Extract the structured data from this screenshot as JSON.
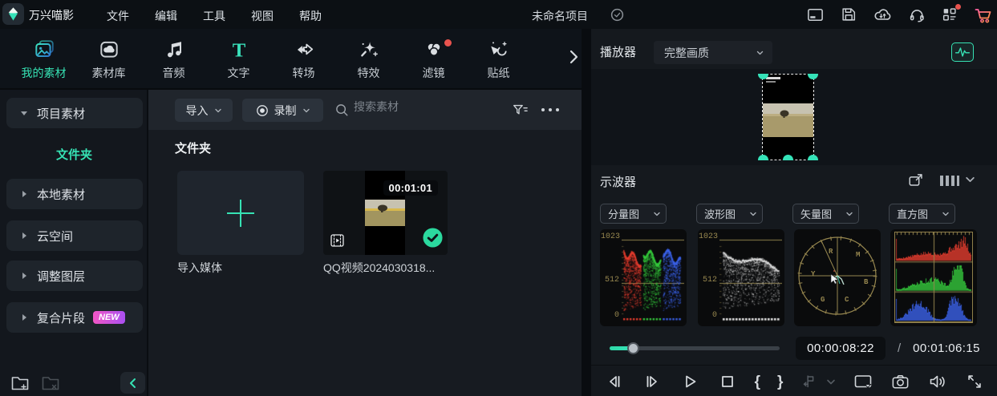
{
  "colors": {
    "accent": "#36e2b4",
    "scope_grid": "#97874f",
    "badge_red": "#e8534e",
    "check_green": "#2bd99e"
  },
  "menubar": {
    "app_name": "万兴喵影",
    "items": [
      {
        "label": "文件"
      },
      {
        "label": "编辑"
      },
      {
        "label": "工具"
      },
      {
        "label": "视图"
      },
      {
        "label": "帮助"
      }
    ],
    "project_name": "未命名项目"
  },
  "tabs": [
    {
      "label": "我的素材",
      "active": true
    },
    {
      "label": "素材库"
    },
    {
      "label": "音频"
    },
    {
      "label": "文字"
    },
    {
      "label": "转场"
    },
    {
      "label": "特效"
    },
    {
      "label": "滤镜",
      "has_badge": true
    },
    {
      "label": "贴纸"
    }
  ],
  "sidebar": {
    "sections": [
      {
        "label": "项目素材",
        "expanded": true
      },
      {
        "label": "文件夹",
        "selected": true
      },
      {
        "label": "本地素材"
      },
      {
        "label": "云空间"
      },
      {
        "label": "调整图层"
      },
      {
        "label": "复合片段",
        "badge": "NEW"
      }
    ]
  },
  "library": {
    "import_button": "导入",
    "record_button": "录制",
    "search_placeholder": "搜索素材",
    "group_title": "文件夹",
    "import_tile_label": "导入媒体",
    "clips": [
      {
        "name": "QQ视频2024030318...",
        "duration": "00:01:01"
      }
    ]
  },
  "player": {
    "title": "播放器",
    "quality_selected": "完整画质",
    "current_time": "00:00:08:22",
    "time_separator": "/",
    "total_time": "00:01:06:15"
  },
  "scopes": {
    "title": "示波器",
    "selectors": [
      {
        "label": "分量图"
      },
      {
        "label": "波形图"
      },
      {
        "label": "矢量图"
      },
      {
        "label": "直方图"
      }
    ],
    "scale_labels": [
      "1023",
      "512",
      "0"
    ],
    "vectorscope_labels": [
      "R",
      "M",
      "Y",
      "B",
      "G",
      "C"
    ]
  },
  "glyphs": {
    "mark_in": "{",
    "mark_out": "}"
  }
}
